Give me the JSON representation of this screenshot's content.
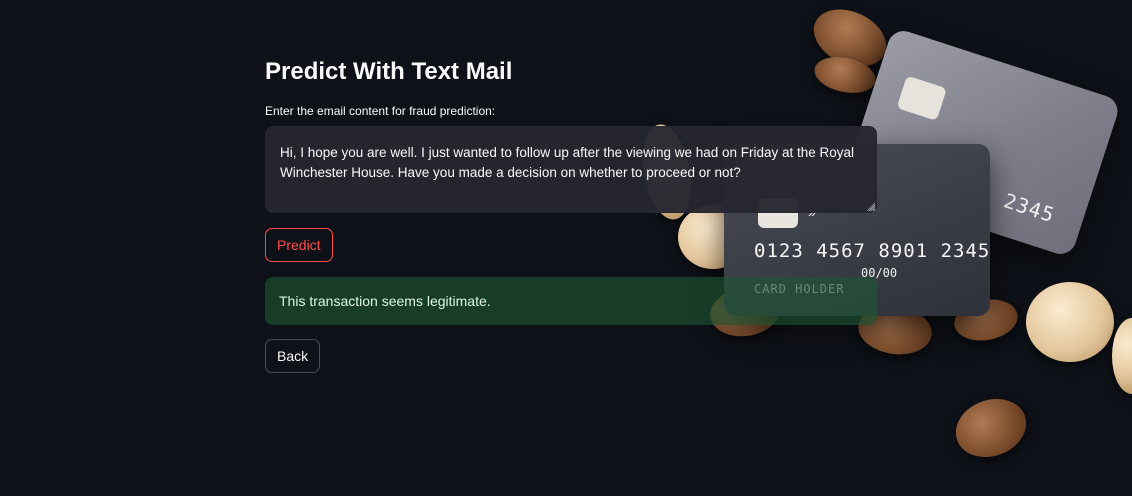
{
  "page": {
    "title": "Predict With Text Mail"
  },
  "form": {
    "label": "Enter the email content for fraud prediction:",
    "email_value": "Hi, I hope you are well. I just wanted to follow up after the viewing we had on Friday at the Royal Winchester House. Have you made a decision on whether to proceed or not?"
  },
  "buttons": {
    "predict_label": "Predict",
    "back_label": "Back"
  },
  "result": {
    "message": "This transaction seems legitimate.",
    "status": "success"
  },
  "background_art": {
    "front_card": {
      "number": "0123 4567 8901 2345",
      "expiry": "00/00",
      "holder": "CARD HOLDER"
    },
    "back_card": {
      "number_fragment": "01 2345"
    }
  },
  "colors": {
    "background": "#0e1117",
    "accent": "#ff4b4b",
    "success_bg": "#1d5734",
    "input_bg": "#262730",
    "text": "#fafafa"
  }
}
